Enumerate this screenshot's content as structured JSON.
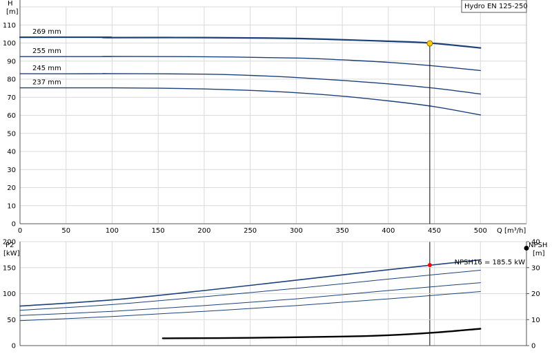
{
  "chart_data": [
    {
      "type": "line",
      "title": "Hydro EN 125-250",
      "ylabel": "H",
      "yunit": "[m]",
      "xlabel": "Q [m³/h]",
      "xlim": [
        0,
        550
      ],
      "ylim": [
        0,
        120
      ],
      "xticks": [
        0,
        50,
        100,
        150,
        200,
        250,
        300,
        350,
        400,
        450,
        500
      ],
      "yticks": [
        0,
        10,
        20,
        30,
        40,
        50,
        60,
        70,
        80,
        90,
        100,
        110
      ],
      "grid": true,
      "series": [
        {
          "name": "269 mm",
          "color": "#1a3f7a",
          "width": 2.2,
          "x": [
            0,
            95,
            95,
            200,
            300,
            400,
            445,
            500
          ],
          "y": [
            103.2,
            103.2,
            103,
            103,
            102.5,
            101,
            100,
            97.3
          ]
        },
        {
          "name": "255 mm",
          "color": "#1a3f7a",
          "width": 1.4,
          "x": [
            0,
            95,
            95,
            200,
            300,
            350,
            400,
            450,
            500
          ],
          "y": [
            92.5,
            92.5,
            92.6,
            92.4,
            91.7,
            90.7,
            89.3,
            87.3,
            84.8
          ]
        },
        {
          "name": "245 mm",
          "color": "#1a3f7a",
          "width": 1.4,
          "x": [
            0,
            95,
            95,
            200,
            250,
            300,
            350,
            400,
            450,
            500
          ],
          "y": [
            83,
            83,
            83.1,
            82.8,
            82.1,
            80.9,
            79.3,
            77.4,
            75,
            71.8
          ]
        },
        {
          "name": "237 mm",
          "color": "#1a3f7a",
          "width": 1.4,
          "x": [
            0,
            100,
            150,
            200,
            250,
            300,
            350,
            400,
            450,
            500
          ],
          "y": [
            75.2,
            75.2,
            75.0,
            74.6,
            73.8,
            72.5,
            70.6,
            68.0,
            64.8,
            60.2
          ]
        }
      ],
      "duty_point": {
        "x": 445,
        "y": 99.8,
        "color": "#ffcc00"
      }
    },
    {
      "type": "line",
      "ylabel": "P2",
      "yunit": "[kW]",
      "ylabel_right": "NPSH",
      "yunit_right": "[m]",
      "xlim": [
        0,
        550
      ],
      "ylim": [
        0,
        200
      ],
      "ylim_right": [
        0,
        40
      ],
      "yticks": [
        0,
        50,
        100,
        150,
        200
      ],
      "yticks_right": [
        0,
        10,
        20,
        30,
        40
      ],
      "grid": true,
      "series": [
        {
          "name": "269 mm",
          "color": "#1a3f7a",
          "width": 1.6,
          "x": [
            0,
            100,
            200,
            300,
            400,
            500
          ],
          "y": [
            76,
            88,
            106,
            126,
            146,
            165
          ]
        },
        {
          "name": "255 mm",
          "color": "#1a3f7a",
          "width": 1,
          "x": [
            0,
            100,
            200,
            300,
            400,
            500
          ],
          "y": [
            68,
            79,
            94,
            110,
            128,
            145
          ]
        },
        {
          "name": "245 mm",
          "color": "#1a3f7a",
          "width": 1,
          "x": [
            0,
            100,
            200,
            300,
            400,
            500
          ],
          "y": [
            58,
            66,
            77,
            90,
            106,
            121
          ]
        },
        {
          "name": "237 mm",
          "color": "#1a3f7a",
          "width": 1,
          "x": [
            0,
            100,
            200,
            300,
            400,
            500
          ],
          "y": [
            48,
            56,
            66,
            77,
            90,
            104
          ]
        },
        {
          "name": "NPSH",
          "axis": "right",
          "color": "#000000",
          "width": 2.4,
          "x": [
            155,
            250,
            350,
            400,
            450,
            500
          ],
          "y": [
            2.8,
            3.0,
            3.5,
            4.0,
            5.0,
            6.5
          ]
        }
      ],
      "power_point": {
        "x": 445,
        "y": 155,
        "color": "#ff0000"
      },
      "npsh_point": {
        "y": 37.5,
        "color": "#000000"
      },
      "annotation": "NPSH16 = 185.5 kW"
    }
  ]
}
